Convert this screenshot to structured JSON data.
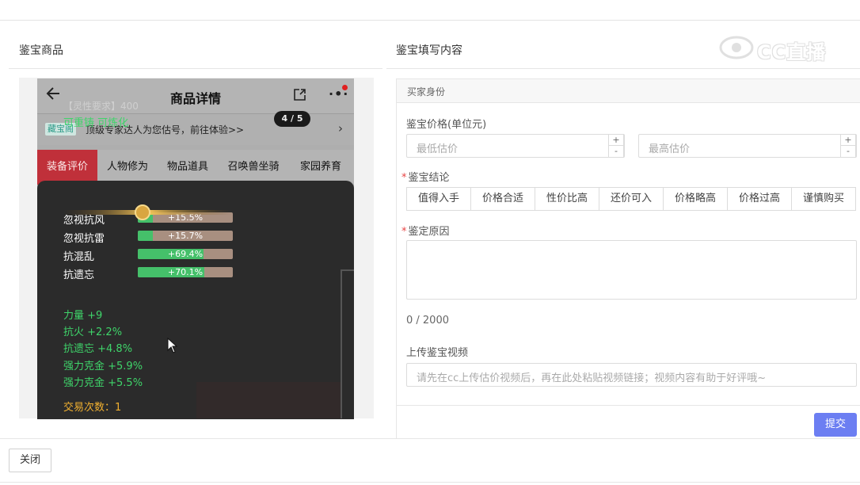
{
  "left_title": "鉴宝商品",
  "right_title": "鉴宝填写内容",
  "watermark": "CC直播",
  "phone": {
    "back_icon": "arrow-left-icon",
    "title": "商品详情",
    "share_icon": "share-icon",
    "more_icon": "more-icon",
    "more_glyph": "·•·",
    "banner_tag": "藏宝阁",
    "banner_text": "顶级专家达人为您估号，前往体验>>",
    "banner_arrow": "›",
    "tabs": [
      "装备评价",
      "人物修为",
      "物品道具",
      "召唤兽坐骑",
      "家园养育"
    ],
    "tip_head": "【灵性要求】400",
    "tip_green": "可重铸 可炼化",
    "pager": "4 / 5",
    "stats": [
      {
        "name": "忽视抗风",
        "value": "+15.5%",
        "pct": 15.5
      },
      {
        "name": "忽视抗雷",
        "value": "+15.7%",
        "pct": 15.7
      },
      {
        "name": "抗混乱",
        "value": "+69.4%",
        "pct": 69.4
      },
      {
        "name": "抗遗忘",
        "value": "+70.1%",
        "pct": 70.1
      }
    ],
    "green_lines": [
      "力量 +9",
      "抗火 +2.2%",
      "抗遗忘 +4.8%",
      "强力克金 +5.9%",
      "强力克金 +5.5%"
    ],
    "trade": "交易次数：1"
  },
  "form": {
    "header": "买家身份",
    "price_label": "鉴宝价格(单位元)",
    "min_placeholder": "最低估价",
    "max_placeholder": "最高估价",
    "plus": "+",
    "minus": "-",
    "conclusion_label": "鉴宝结论",
    "required_mark": "*",
    "conclusions": [
      "值得入手",
      "价格合适",
      "性价比高",
      "还价可入",
      "价格略高",
      "价格过高",
      "谨慎购买"
    ],
    "reason_label": "鉴定原因",
    "counter": "0 / 2000",
    "video_label": "上传鉴宝视频",
    "video_placeholder": "请先在cc上传估价视频后，再在此处粘贴视频链接；视频内容有助于好评哦~",
    "submit": "提交"
  },
  "close": "关闭"
}
